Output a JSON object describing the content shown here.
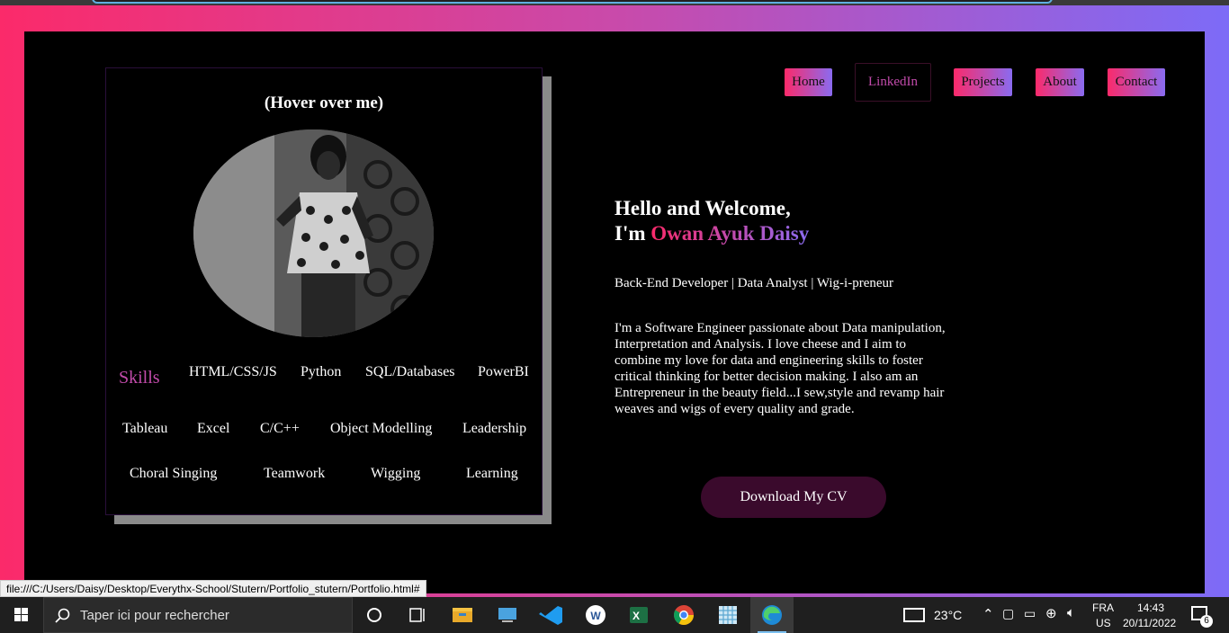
{
  "nav": [
    "Home",
    "LinkedIn",
    "Projects",
    "About",
    "Contact"
  ],
  "card": {
    "hover_title": "(Hover over me)",
    "skills_label": "Skills",
    "skills": [
      "HTML/CSS/JS",
      "Python",
      "SQL/Databases",
      "PowerBI",
      "Tableau",
      "Excel",
      "C/C++",
      "Object Modelling",
      "Leadership",
      "Choral Singing",
      "Teamwork",
      "Wigging",
      "Learning"
    ]
  },
  "hero": {
    "greeting": "Hello and Welcome,",
    "im": "I'm",
    "name": "Owan Ayuk Daisy",
    "roles": "Back-End Developer | Data Analyst | Wig-i-preneur",
    "bio": "I'm a Software Engineer passionate about Data manipulation, Interpretation and Analysis. I love cheese and I aim to combine my love for data and engineering skills to foster critical thinking for better decision making. I also am an Entrepreneur in the beauty field...I sew,style and revamp hair weaves and wigs of every quality and grade.",
    "cv_button": "Download My CV"
  },
  "status_url": "file:///C:/Users/Daisy/Desktop/Everythx-School/Stutern/Portfolio_stutern/Portfolio.html#",
  "taskbar": {
    "search_placeholder": "Taper ici pour rechercher",
    "weather": "23°C",
    "lang": "FRA",
    "layout": "US",
    "time": "14:43",
    "date": "20/11/2022",
    "notifications": "6",
    "apps": [
      "task-view-icon",
      "file-explorer-icon",
      "remote-desktop-icon",
      "vscode-icon",
      "word-app-icon",
      "excel-icon",
      "chrome-icon",
      "snipping-tool-icon",
      "edge-icon"
    ]
  },
  "colors": {
    "accent_start": "#fb2a6a",
    "accent_end": "#7d6bf7",
    "skills_label": "#c24bab",
    "cv_button": "#3a0a2c"
  }
}
